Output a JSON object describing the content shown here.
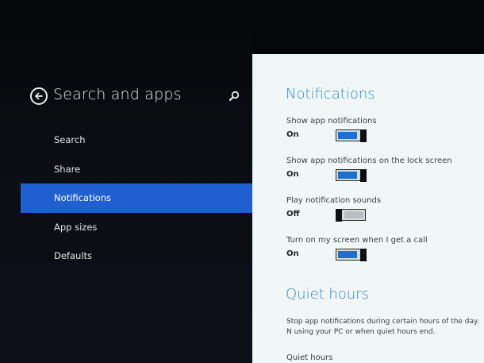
{
  "nav": {
    "title": "Search and apps",
    "items": [
      {
        "label": "Search",
        "selected": false
      },
      {
        "label": "Share",
        "selected": false
      },
      {
        "label": "Notifications",
        "selected": true
      },
      {
        "label": "App sizes",
        "selected": false
      },
      {
        "label": "Defaults",
        "selected": false
      }
    ]
  },
  "content": {
    "notifications": {
      "heading": "Notifications",
      "settings": [
        {
          "label": "Show app notifications",
          "state": "On",
          "on": true
        },
        {
          "label": "Show app notifications on the lock screen",
          "state": "On",
          "on": true
        },
        {
          "label": "Play notification sounds",
          "state": "Off",
          "on": false
        },
        {
          "label": "Turn on my screen when I get a call",
          "state": "On",
          "on": true
        }
      ]
    },
    "quiet_hours": {
      "heading": "Quiet hours",
      "description": "Stop app notifications during certain hours of the day. N using your PC or when quiet hours end.",
      "sub_label": "Quiet hours"
    }
  },
  "colors": {
    "accent": "#1f5fd0",
    "heading": "#2e86c6",
    "toggle_on": "#1f6fcf",
    "pane_background": "#f1f6f7"
  },
  "icons": {
    "back": "back-arrow-circle-icon",
    "search": "search-icon"
  }
}
